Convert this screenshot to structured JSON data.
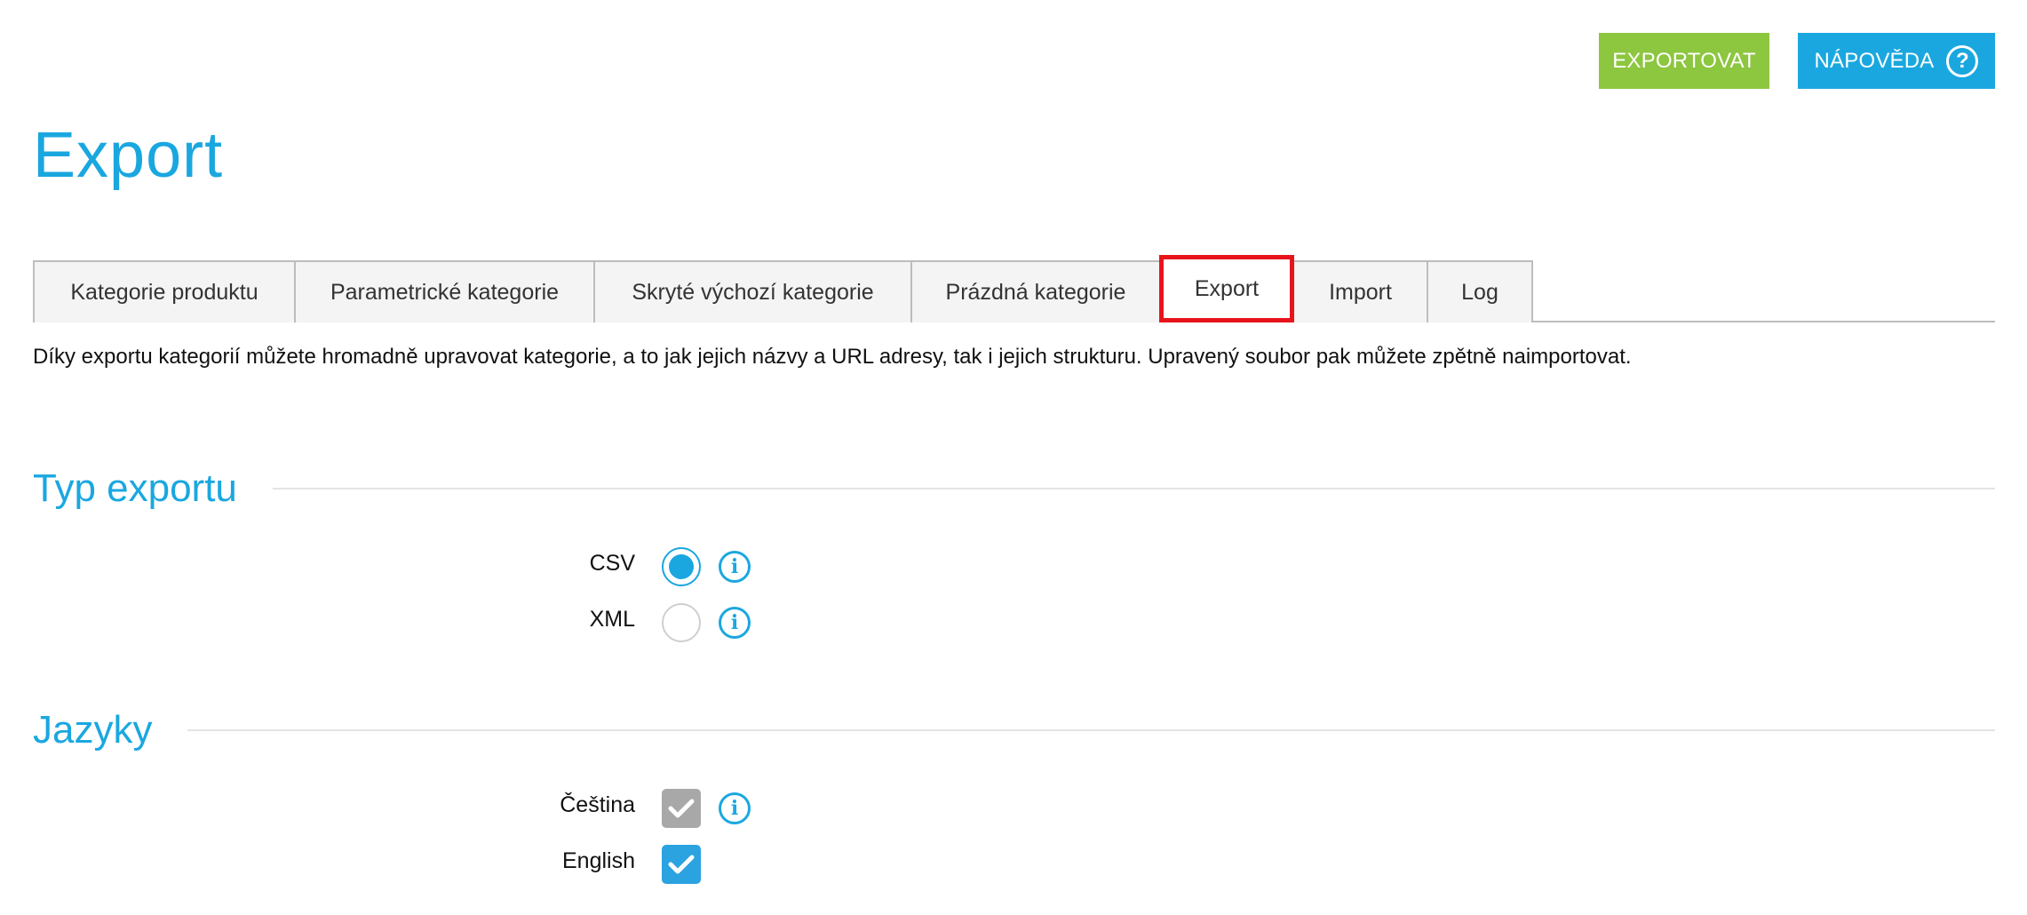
{
  "header": {
    "export_button": "EXPORTOVAT",
    "help_button": "NÁPOVĚDA",
    "help_icon_glyph": "?"
  },
  "page": {
    "title": "Export"
  },
  "tabs": [
    {
      "label": "Kategorie produktu",
      "active": false
    },
    {
      "label": "Parametrické kategorie",
      "active": false
    },
    {
      "label": "Skryté výchozí kategorie",
      "active": false
    },
    {
      "label": "Prázdná kategorie",
      "active": false
    },
    {
      "label": "Export",
      "active": true
    },
    {
      "label": "Import",
      "active": false
    },
    {
      "label": "Log",
      "active": false
    }
  ],
  "description": "Díky exportu kategorií můžete hromadně upravovat kategorie, a to jak jejich názvy a URL adresy, tak i jejich strukturu. Upravený soubor pak můžete zpětně naimportovat.",
  "export_type": {
    "title": "Typ exportu",
    "options": [
      {
        "label": "CSV",
        "selected": true
      },
      {
        "label": "XML",
        "selected": false
      }
    ]
  },
  "languages": {
    "title": "Jazyky",
    "options": [
      {
        "label": "Čeština",
        "checked": true,
        "disabled": true
      },
      {
        "label": "English",
        "checked": true,
        "disabled": false
      }
    ]
  },
  "icons": {
    "info": "info-icon",
    "check": "checkmark-icon",
    "help": "question-mark-icon"
  },
  "colors": {
    "accent": "#1aa7e0",
    "export_button": "#8dc63f",
    "active_tab_border": "#e8141b",
    "disabled_checkbox": "#a8a8a8"
  }
}
